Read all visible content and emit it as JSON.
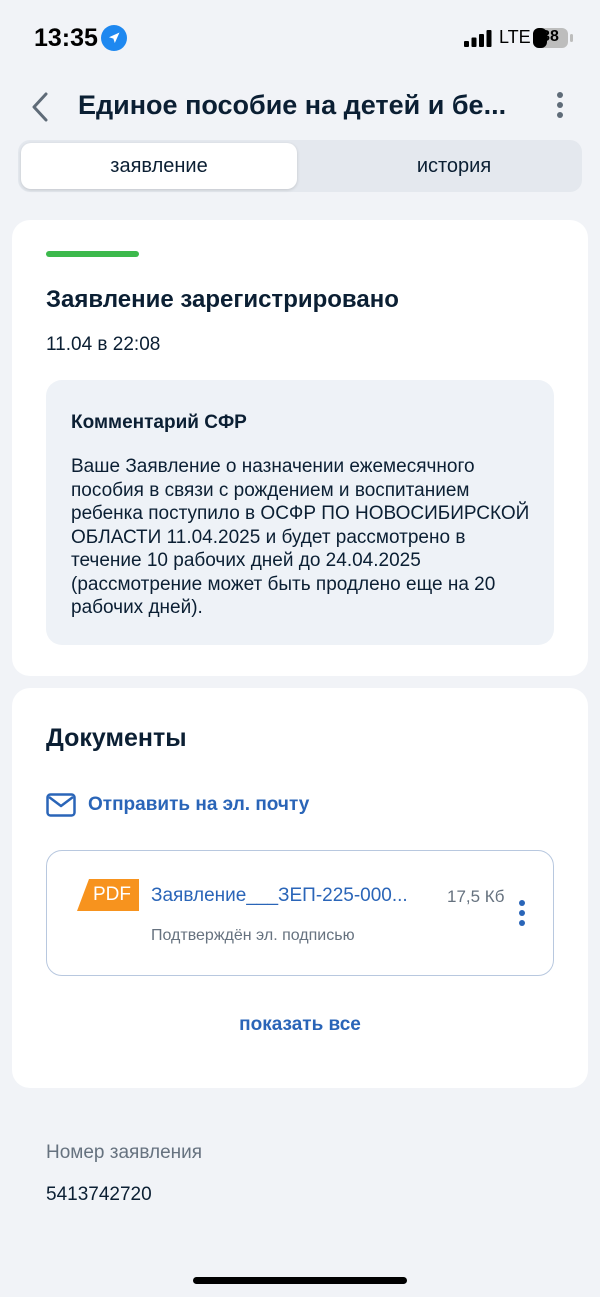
{
  "status_bar": {
    "time": "13:35",
    "network": "LTE",
    "battery": "38",
    "icons": [
      "location-arrow-icon",
      "signal-bars-icon",
      "battery-icon"
    ]
  },
  "header": {
    "title": "Единое пособие на детей и бе...",
    "icons": [
      "chevron-left-icon",
      "vertical-dots-icon"
    ]
  },
  "tabs": [
    {
      "label": "заявление",
      "active": true
    },
    {
      "label": "история",
      "active": false
    }
  ],
  "status_card": {
    "accent_color": "#3cb94c",
    "title": "Заявление зарегистрировано",
    "date": "11.04 в 22:08",
    "comment": {
      "title": "Комментарий СФР",
      "text": "Ваше Заявление о назначении ежемесячного пособия в связи с рождением и воспитанием ребенка поступило в ОСФР ПО НОВОСИБИРСКОЙ ОБЛАСТИ 11.04.2025 и будет рассмотрено в течение 10 рабочих дней до 24.04.2025 (рассмотрение может быть продлено еще на 20 рабочих дней)."
    }
  },
  "documents": {
    "title": "Документы",
    "send_email_label": "Отправить на эл. почту",
    "items": [
      {
        "badge": "PDF",
        "name": "Заявление___ЗЕП-225-000...",
        "size": "17,5 Кб",
        "subtitle": "Подтверждён эл. подписью"
      }
    ],
    "show_all_label": "показать все"
  },
  "application": {
    "number_label": "Номер заявления",
    "number_value": "5413742720"
  },
  "colors": {
    "link": "#2a65b8",
    "pdf_badge": "#f7931e",
    "status_green": "#3cb94c",
    "background": "#f1f3f7"
  }
}
